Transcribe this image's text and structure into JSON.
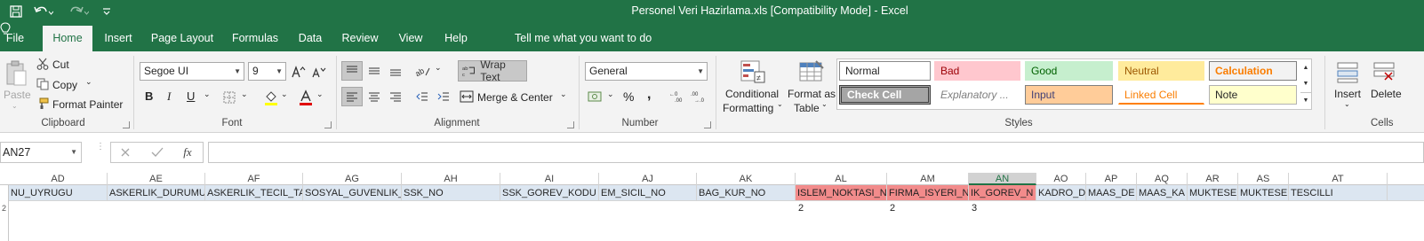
{
  "window": {
    "title": "Personel Veri Hazirlama.xls  [Compatibility Mode]  -  Excel"
  },
  "qat": {
    "save_icon": "save-icon",
    "undo_icon": "undo-icon",
    "redo_icon": "redo-icon",
    "customize_icon": "customize-icon"
  },
  "tabs": [
    "File",
    "Home",
    "Insert",
    "Page Layout",
    "Formulas",
    "Data",
    "Review",
    "View",
    "Help"
  ],
  "tell_me": "Tell me what you want to do",
  "clipboard": {
    "paste": "Paste",
    "cut": "Cut",
    "copy": "Copy",
    "format_painter": "Format Painter",
    "label": "Clipboard"
  },
  "font": {
    "name": "Segoe UI",
    "size": "9",
    "bold": "B",
    "italic": "I",
    "underline": "U",
    "label": "Font"
  },
  "alignment": {
    "wrap_text": "Wrap Text",
    "merge_center": "Merge & Center",
    "label": "Alignment"
  },
  "number": {
    "format": "General",
    "percent": "%",
    "comma": ",",
    "label": "Number"
  },
  "styles": {
    "conditional_formatting": [
      "Conditional",
      "Formatting"
    ],
    "format_as_table": [
      "Format as",
      "Table"
    ],
    "cells": {
      "normal": "Normal",
      "bad": "Bad",
      "good": "Good",
      "neutral": "Neutral",
      "calculation": "Calculation",
      "check_cell": "Check Cell",
      "explanatory": "Explanatory ...",
      "input": "Input",
      "linked_cell": "Linked Cell",
      "note": "Note"
    },
    "label": "Styles"
  },
  "cells_group": {
    "insert": "Insert",
    "delete": "Delete",
    "label": "Cells"
  },
  "formula_bar": {
    "name_box": "AN27",
    "fx": "fx",
    "value": ""
  },
  "columns": [
    "AD",
    "AE",
    "AF",
    "AG",
    "AH",
    "AI",
    "AJ",
    "AK",
    "AL",
    "AM",
    "AN",
    "AO",
    "AP",
    "AQ",
    "AR",
    "AS",
    "AT"
  ],
  "header_row": [
    "NU_UYRUGU",
    "ASKERLIK_DURUMU",
    "ASKERLIK_TECIL_TARI",
    "SOSYAL_GUVENLIK_K",
    "SSK_NO",
    "SSK_GOREV_KODU",
    "EM_SICIL_NO",
    "BAG_KUR_NO",
    "ISLEM_NOKTASI_N",
    "FIRMA_ISYERI_N",
    "IK_GOREV_N",
    "KADRO_D",
    "MAAS_DE",
    "MAAS_KA",
    "MUKTESE",
    "MUKTESE",
    "TESCILLI"
  ],
  "row2": {
    "AL": "2",
    "AM": "2",
    "AN": "3"
  },
  "row_numbers": [
    "2"
  ]
}
